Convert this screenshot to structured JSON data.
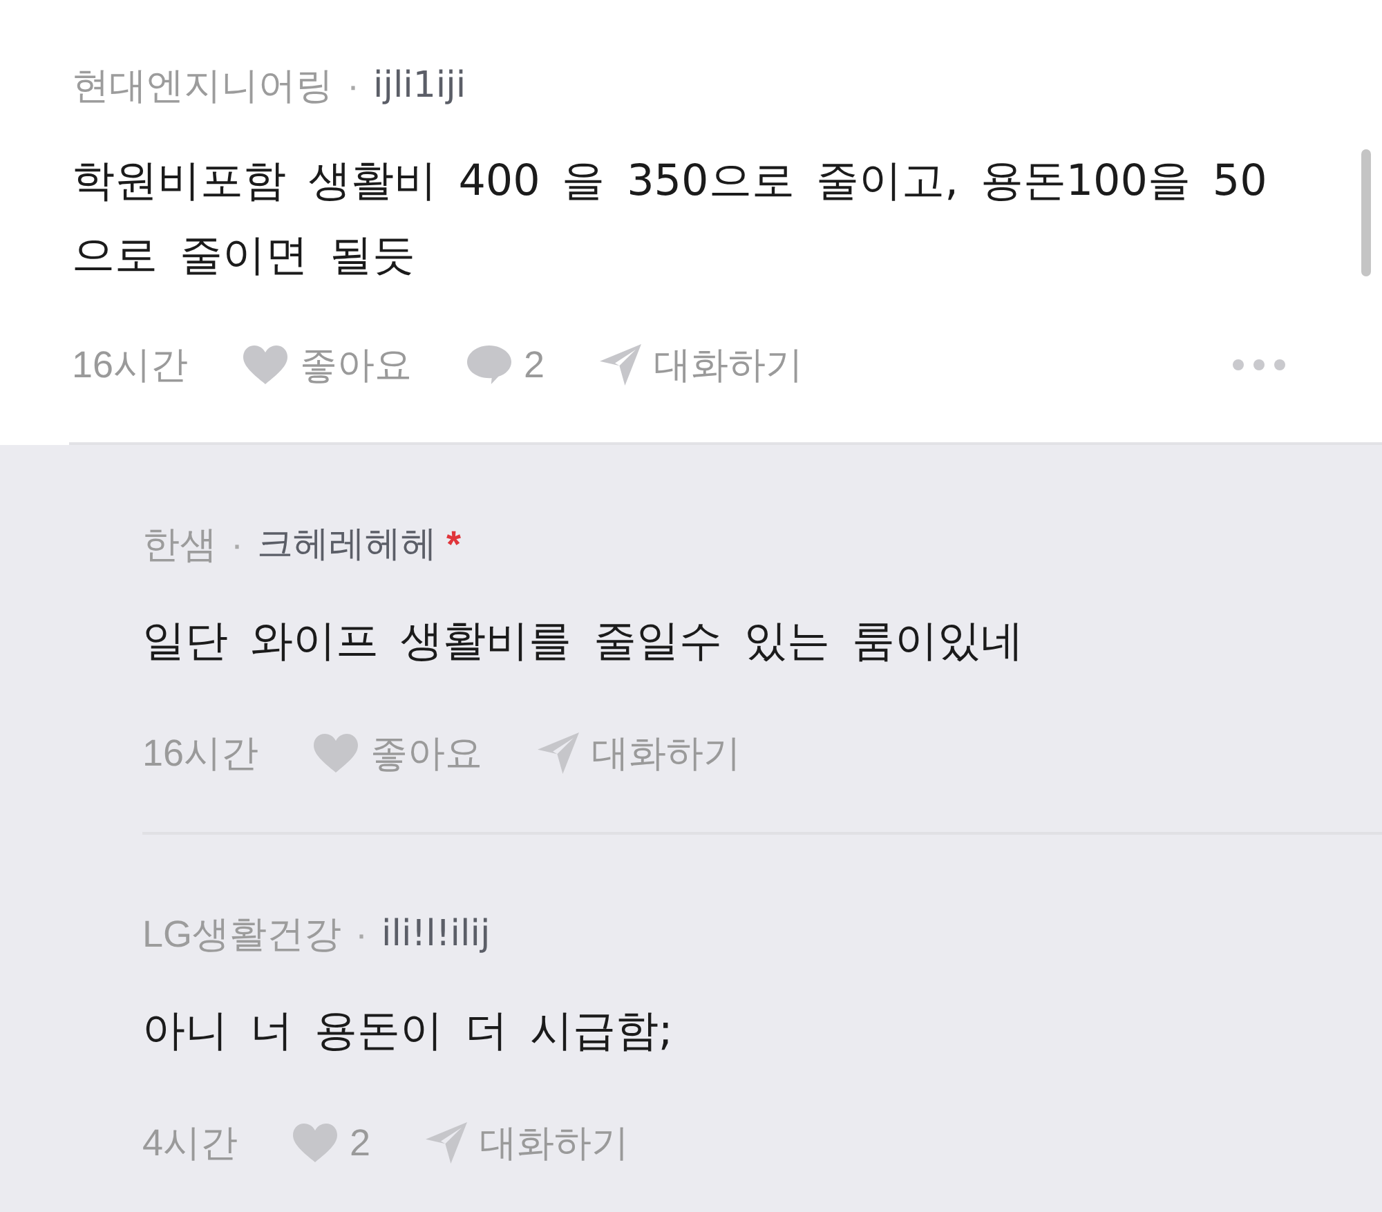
{
  "post": {
    "meta": {
      "company": "현대엔지니어링",
      "separator": "·",
      "nickname": "ijli1iji"
    },
    "body": "학원비포함 생활비 400 을 350으로 줄이고, 용돈100을 50으로 줄이면 될듯",
    "actions": [
      {
        "kind": "time",
        "text": "16시간"
      },
      {
        "kind": "like",
        "text": "좋아요"
      },
      {
        "kind": "comment",
        "text": "2"
      },
      {
        "kind": "chat",
        "text": "대화하기"
      }
    ]
  },
  "replies": [
    {
      "meta": {
        "company": "한샘",
        "separator": "·",
        "nickname": "크헤레헤헤",
        "mark": "*"
      },
      "body": "일단 와이프 생활비를 줄일수 있는 룸이있네",
      "actions": [
        {
          "kind": "time",
          "text": "16시간"
        },
        {
          "kind": "like",
          "text": "좋아요"
        },
        {
          "kind": "chat",
          "text": "대화하기"
        }
      ]
    },
    {
      "meta": {
        "company": "LG생활건강",
        "separator": "·",
        "nickname": "ili!l!ilij"
      },
      "body": "아니 너 용돈이 더 시급함;",
      "actions": [
        {
          "kind": "time",
          "text": "4시간"
        },
        {
          "kind": "like",
          "text": "2"
        },
        {
          "kind": "chat",
          "text": "대화하기"
        }
      ]
    }
  ]
}
